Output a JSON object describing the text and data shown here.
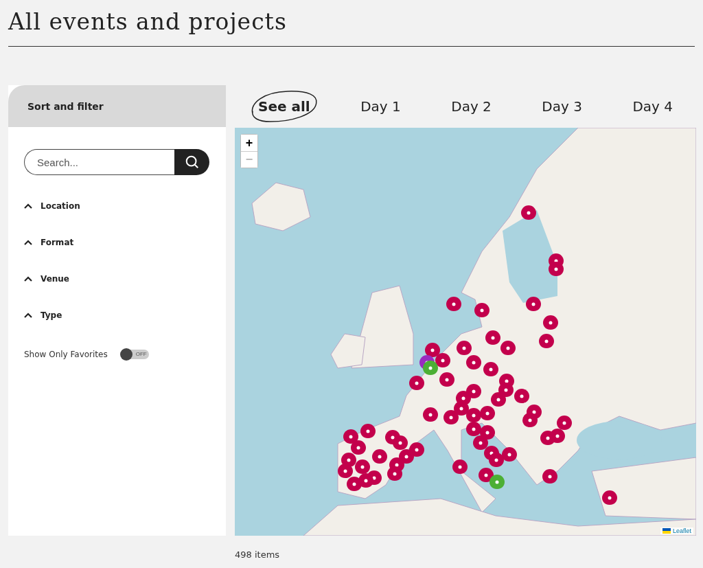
{
  "page": {
    "title": "All events and projects"
  },
  "sidebar": {
    "title": "Sort and filter",
    "search": {
      "placeholder": "Search..."
    },
    "filters": [
      {
        "label": "Location",
        "expanded": true
      },
      {
        "label": "Format",
        "expanded": true
      },
      {
        "label": "Venue",
        "expanded": true
      },
      {
        "label": "Type",
        "expanded": true
      }
    ],
    "favorites_toggle": {
      "label": "Show Only Favorites",
      "on": false,
      "state_text": "OFF"
    }
  },
  "tabs": [
    {
      "label": "See all",
      "selected": true
    },
    {
      "label": "Day 1",
      "selected": false
    },
    {
      "label": "Day 2",
      "selected": false
    },
    {
      "label": "Day 3",
      "selected": false
    },
    {
      "label": "Day 4",
      "selected": false
    }
  ],
  "map": {
    "kind": "picture",
    "zoom_in": {
      "label": "+",
      "disabled": false
    },
    "zoom_out": {
      "label": "−",
      "disabled": true
    },
    "attribution": "Leaflet"
  },
  "results": {
    "count": "498 items"
  }
}
